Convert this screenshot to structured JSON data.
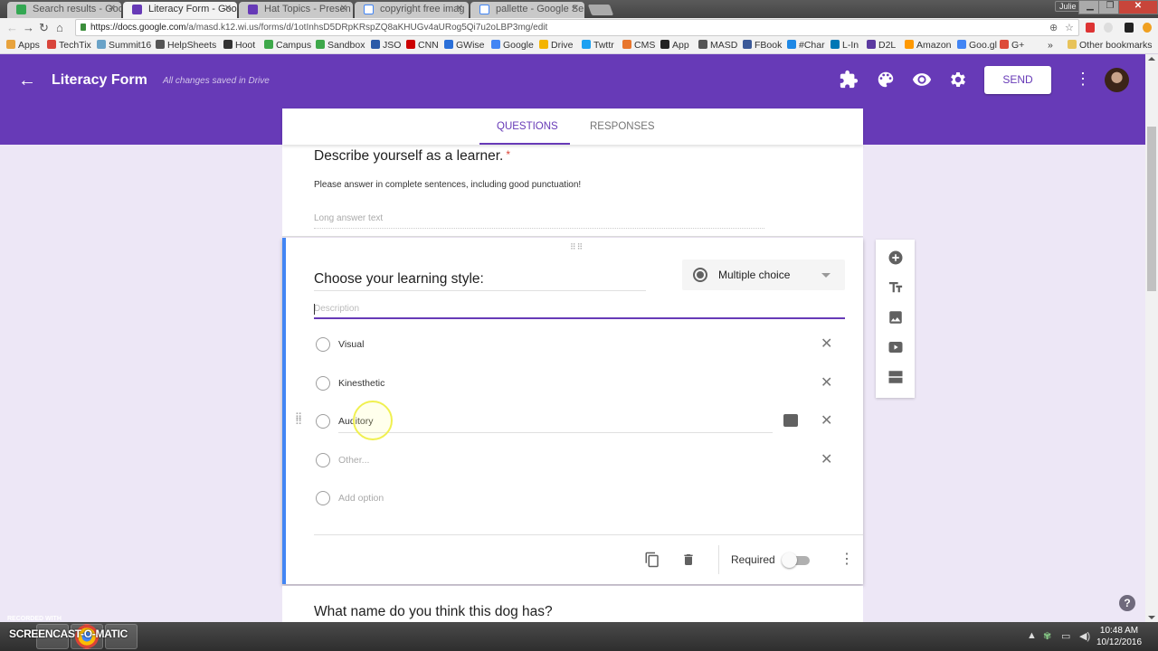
{
  "browser": {
    "tabs": [
      {
        "label": "Search results - Goo",
        "favicon_color": "#34a853",
        "active": false
      },
      {
        "label": "Literacy Form - Goo",
        "favicon_color": "#673ab7",
        "active": true
      },
      {
        "label": "Hat Topics - Presen",
        "favicon_color": "#673ab7",
        "active": false
      },
      {
        "label": "copyright free imag",
        "favicon_color": "#4285f4",
        "active": false
      },
      {
        "label": "pallette - Google Se",
        "favicon_color": "#4285f4",
        "active": false
      }
    ],
    "user_badge": "Julie",
    "url_host": "https://docs.google.com",
    "url_path": "/a/masd.k12.wi.us/forms/d/1otInhsD5DRpKRspZQ8aKHUGv4aURog5Qi7u2oLBP3mg/edit",
    "bookmarks": [
      {
        "label": "Apps",
        "color": "#e8a33d"
      },
      {
        "label": "TechTix",
        "color": "#d9453b"
      },
      {
        "label": "Summit16",
        "color": "#6aa3c8"
      },
      {
        "label": "HelpSheets",
        "color": "#555555"
      },
      {
        "label": "Hoot",
        "color": "#333333"
      },
      {
        "label": "Campus",
        "color": "#3ea84a"
      },
      {
        "label": "Sandbox",
        "color": "#3ea84a"
      },
      {
        "label": "JSO",
        "color": "#2b5aa8"
      },
      {
        "label": "CNN",
        "color": "#cc0000"
      },
      {
        "label": "GWise",
        "color": "#2a6fd8"
      },
      {
        "label": "Google",
        "color": "#4285f4"
      },
      {
        "label": "Drive",
        "color": "#f4b400"
      },
      {
        "label": "Twttr",
        "color": "#1da1f2"
      },
      {
        "label": "CMS",
        "color": "#e8762d"
      },
      {
        "label": "App",
        "color": "#222222"
      },
      {
        "label": "MASD",
        "color": "#555555"
      },
      {
        "label": "FBook",
        "color": "#3b5998"
      },
      {
        "label": "#Char",
        "color": "#1e88e5"
      },
      {
        "label": "L-In",
        "color": "#0077b5"
      },
      {
        "label": "D2L",
        "color": "#5c3aa0"
      },
      {
        "label": "Amazon",
        "color": "#ff9900"
      },
      {
        "label": "Goo.gl",
        "color": "#4285f4"
      },
      {
        "label": "G+",
        "color": "#dd4b39"
      }
    ],
    "bookmarks_overflow": "»",
    "other_bookmarks": "Other bookmarks"
  },
  "header": {
    "title": "Literacy Form",
    "save_status": "All changes saved in Drive",
    "send_label": "SEND",
    "accent": "#673ab7"
  },
  "form_tabs": [
    {
      "label": "QUESTIONS",
      "active": true
    },
    {
      "label": "RESPONSES",
      "active": false
    }
  ],
  "question1": {
    "title": "Describe yourself as a learner.",
    "required_mark": "*",
    "description": "Please answer in complete sentences, including good punctuation!",
    "answer_placeholder": "Long answer text"
  },
  "question2": {
    "title": "Choose your learning style:",
    "type": "Multiple choice",
    "description_placeholder": "Description",
    "options": [
      {
        "label": "Visual"
      },
      {
        "label": "Kinesthetic"
      },
      {
        "label": "Auditory"
      }
    ],
    "other_placeholder": "Other...",
    "add_option": "Add option",
    "required_label": "Required",
    "required_on": false
  },
  "question3": {
    "title": "What name do you think this dog has?"
  },
  "taskbar": {
    "recorded_with": "RECORDED WITH",
    "screencast": "SCREENCAST-O-MATIC",
    "time": "10:48 AM",
    "date": "10/12/2016"
  }
}
